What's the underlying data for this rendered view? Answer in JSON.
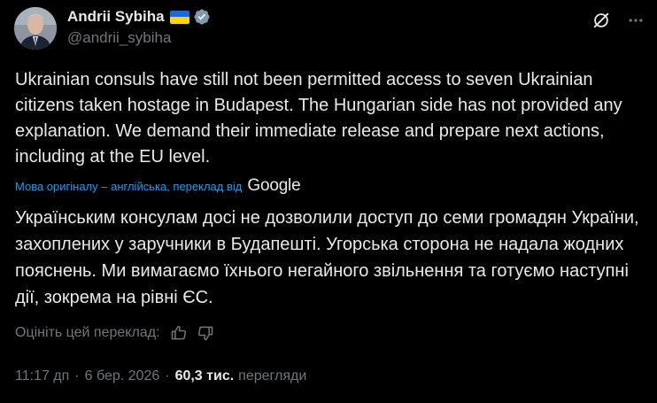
{
  "author": {
    "name": "Andrii Sybiha",
    "handle": "@andrii_sybiha"
  },
  "icons": {
    "flag": "ukraine-flag-icon",
    "verified": "verified-badge-icon",
    "grok": "grok-icon",
    "more": "more-options-icon",
    "like": "thumbs-up-icon",
    "dislike": "thumbs-down-icon"
  },
  "tweet": {
    "original_text": "Ukrainian consuls have still not been permitted access to seven Ukrainian citizens taken hostage in Budapest. The Hungarian side has not provided any explanation. We demand their immediate release and prepare next actions, including at the EU level.",
    "translation_note": "Мова оригіналу – англійська, переклад від",
    "translation_provider": "Google",
    "translated_text": "Українським консулам досі не дозволили доступ до семи громадян України, захоплених у заручники в Будапешті. Угорська сторона не надала жодних пояснень. Ми вимагаємо їхнього негайного звільнення та готуємо наступні дії, зокрема на рівні ЄС.",
    "rate_prompt": "Оцініть цей переклад:",
    "time": "11:17 дп",
    "date": "6 бер. 2026",
    "views_count": "60,3 тис.",
    "views_label": "перегляди"
  },
  "colors": {
    "background": "#000000",
    "text": "#e7e9ea",
    "secondary": "#71767b",
    "link": "#1d9bf0"
  }
}
